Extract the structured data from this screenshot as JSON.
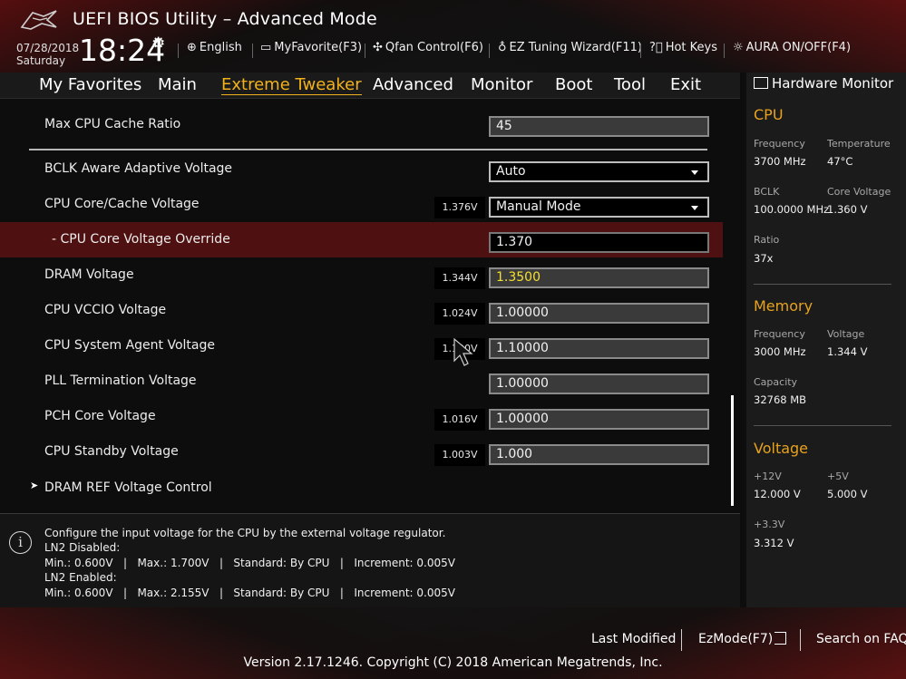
{
  "header": {
    "app_title": "UEFI BIOS Utility – Advanced Mode",
    "date": "07/28/2018",
    "day": "Saturday",
    "time": "18:24"
  },
  "toolbar": {
    "language": "English",
    "myfavorite": "MyFavorite(F3)",
    "qfan": "Qfan Control(F6)",
    "ez_tuning": "EZ Tuning Wizard(F11)",
    "hotkeys": "Hot Keys",
    "aura": "AURA ON/OFF(F4)"
  },
  "nav": {
    "tabs": [
      "My Favorites",
      "Main",
      "Extreme Tweaker",
      "Advanced",
      "Monitor",
      "Boot",
      "Tool",
      "Exit"
    ],
    "active": "Extreme Tweaker"
  },
  "settings": [
    {
      "label": "Max CPU Cache Ratio",
      "value": "45"
    },
    {
      "label": "BCLK Aware Adaptive Voltage",
      "value": "Auto"
    },
    {
      "label": "CPU Core/Cache Voltage",
      "reading": "1.376V",
      "value": "Manual Mode"
    },
    {
      "label": "- CPU Core Voltage Override",
      "value": "1.370"
    },
    {
      "label": "DRAM Voltage",
      "reading": "1.344V",
      "value": "1.3500"
    },
    {
      "label": "CPU VCCIO Voltage",
      "reading": "1.024V",
      "value": "1.00000"
    },
    {
      "label": "CPU System Agent Voltage",
      "reading": "1.120V",
      "value": "1.10000"
    },
    {
      "label": "PLL Termination Voltage",
      "value": "1.00000"
    },
    {
      "label": "PCH Core Voltage",
      "reading": "1.016V",
      "value": "1.00000"
    },
    {
      "label": "CPU Standby Voltage",
      "reading": "1.003V",
      "value": "1.000"
    },
    {
      "label": "DRAM REF Voltage Control"
    }
  ],
  "help": {
    "line1": "Configure the input voltage for the CPU by the external voltage regulator.",
    "line2": "LN2 Disabled:",
    "line3": "Min.: 0.600V   |   Max.: 1.700V   |   Standard: By CPU   |   Increment: 0.005V",
    "line4": "LN2 Enabled:",
    "line5": "Min.: 0.600V   |   Max.: 2.155V   |   Standard: By CPU   |   Increment: 0.005V"
  },
  "hw_monitor": {
    "title": "Hardware Monitor",
    "cpu": {
      "heading": "CPU",
      "frequency_label": "Frequency",
      "frequency": "3700 MHz",
      "temperature_label": "Temperature",
      "temperature": "47°C",
      "bclk_label": "BCLK",
      "bclk": "100.0000 MHz",
      "core_voltage_label": "Core Voltage",
      "core_voltage": "1.360 V",
      "ratio_label": "Ratio",
      "ratio": "37x"
    },
    "memory": {
      "heading": "Memory",
      "frequency_label": "Frequency",
      "frequency": "3000 MHz",
      "voltage_label": "Voltage",
      "voltage": "1.344 V",
      "capacity_label": "Capacity",
      "capacity": "32768 MB"
    },
    "voltage": {
      "heading": "Voltage",
      "v12_label": "+12V",
      "v12": "12.000 V",
      "v5_label": "+5V",
      "v5": "5.000 V",
      "v33_label": "+3.3V",
      "v33": "3.312 V"
    }
  },
  "footer": {
    "last_modified": "Last Modified",
    "ezmode": "EzMode(F7)",
    "search_faq": "Search on FAQ",
    "version": "Version 2.17.1246. Copyright (C) 2018 American Megatrends, Inc."
  },
  "colors": {
    "accent": "#f2b21c",
    "selected_row": "#4e1010",
    "dram_value": "#f4e030"
  }
}
